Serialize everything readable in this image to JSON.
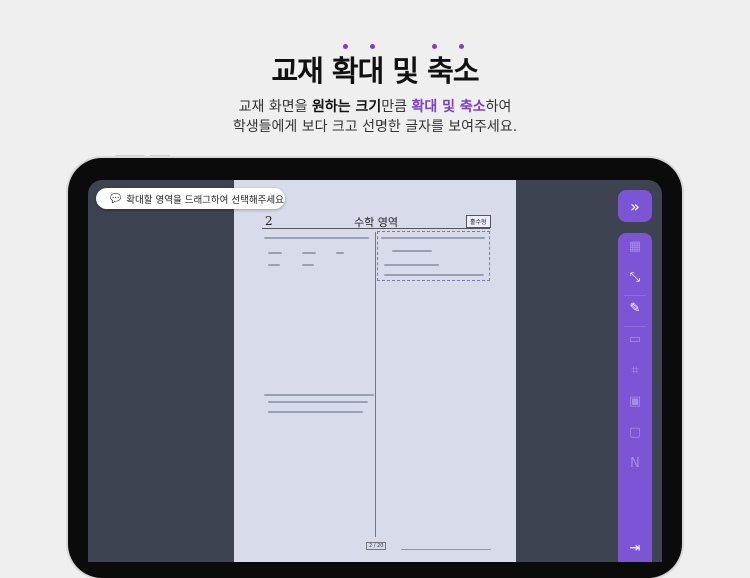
{
  "header": {
    "title": "교재 확대 및 축소",
    "sub_line1": {
      "a": "교재 화면을 ",
      "b": "원하는 크기",
      "c": "만큼 ",
      "d": "확대 및 축소",
      "e": "하여"
    },
    "sub_line2": "학생들에게 보다 크고 선명한 글자를 보여주세요."
  },
  "accent": "#7a3fd1",
  "tooltip": {
    "text": "확대할 영역을 드래그하여 선택해주세요",
    "icon": "chat-icon"
  },
  "document": {
    "page_number": "2",
    "subject": "수학 영역",
    "type_badge": "홀수형",
    "page_indicator": "2 / 20"
  },
  "toolbar": {
    "expand": "»",
    "items": [
      "grid-icon",
      "shrink-icon",
      "pencil-icon",
      "board-icon",
      "crop-icon",
      "window-icon",
      "video-icon",
      "eraser-icon"
    ],
    "exit": "exit-icon"
  }
}
